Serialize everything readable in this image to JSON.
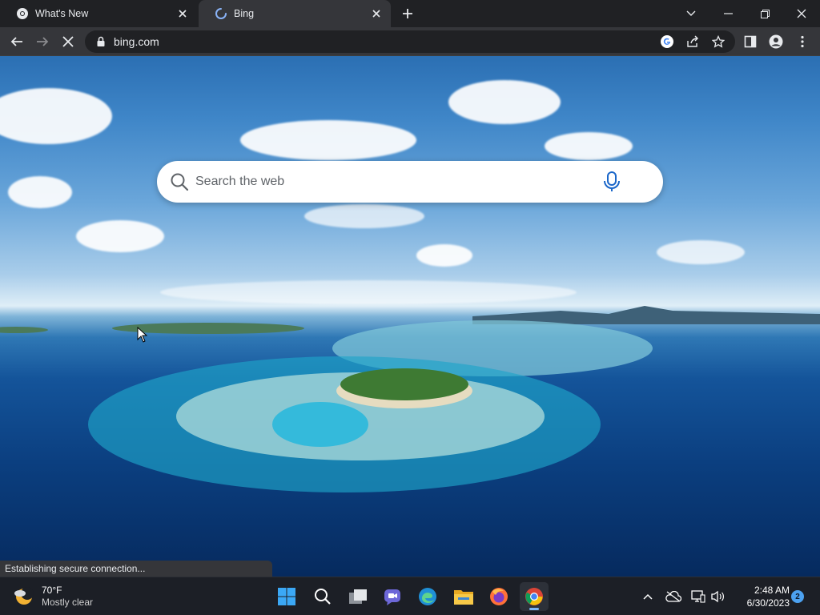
{
  "tabs": [
    {
      "title": "What's New",
      "favicon": "chrome-icon",
      "active": false
    },
    {
      "title": "Bing",
      "favicon": "loading-spinner-icon",
      "active": true
    }
  ],
  "toolbar": {
    "url": "bing.com",
    "icons": [
      "back-icon",
      "forward-icon",
      "stop-loading-icon",
      "lock-icon",
      "google-icon",
      "share-icon",
      "star-icon",
      "side-panel-icon",
      "profile-icon",
      "menu-icon"
    ]
  },
  "search": {
    "placeholder": "Search the web"
  },
  "status": {
    "text": "Establishing secure connection..."
  },
  "taskbar": {
    "weather": {
      "temp": "70°F",
      "condition": "Mostly clear"
    },
    "apps": [
      "windows-start-icon",
      "search-icon",
      "task-view-icon",
      "teams-chat-icon",
      "edge-icon",
      "file-explorer-icon",
      "firefox-icon",
      "chrome-icon"
    ],
    "clock": {
      "time": "2:48 AM",
      "date": "6/30/2023"
    },
    "notification_count": "2"
  },
  "colors": {
    "tab_bg": "#202124",
    "toolbar_bg": "#35363a",
    "taskbar_bg": "#1c1f26",
    "accent": "#4ca1f0"
  }
}
